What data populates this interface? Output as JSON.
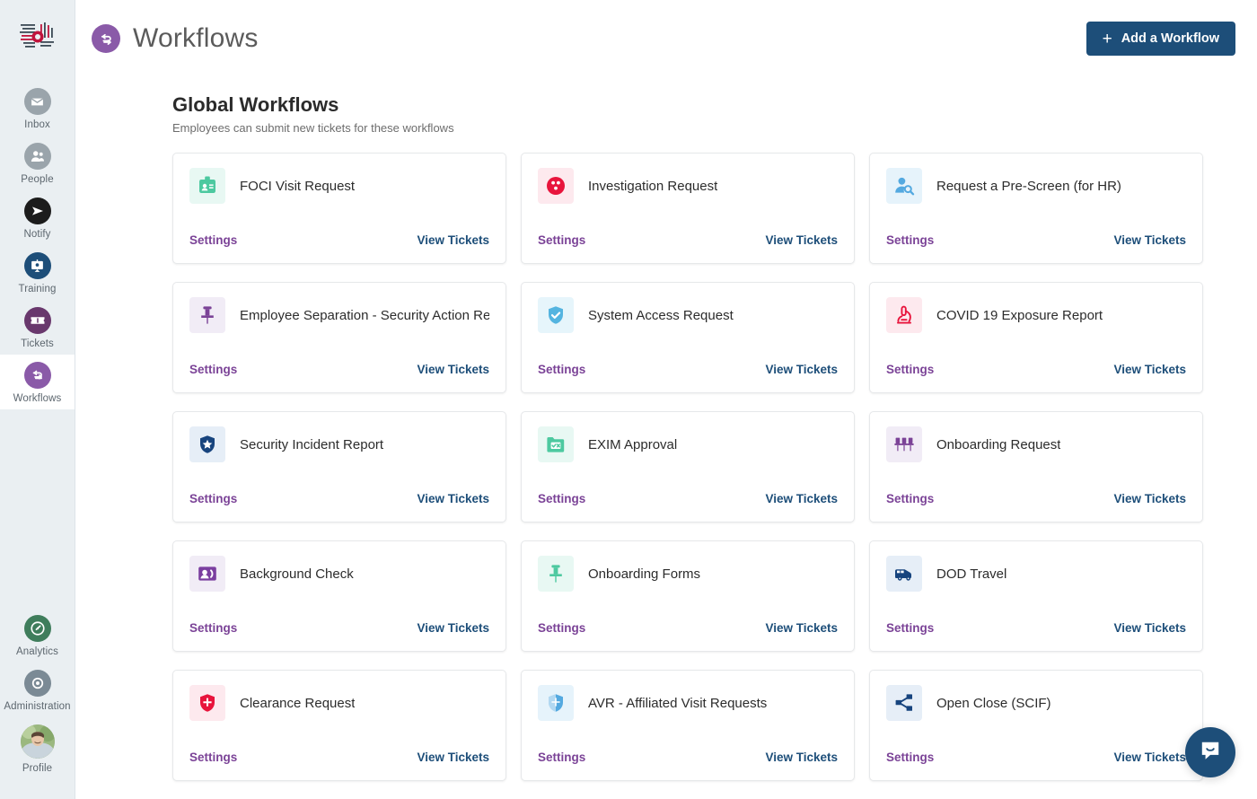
{
  "sidebar": {
    "logo_name": "company-logo",
    "items": [
      {
        "label": "Inbox",
        "icon": "inbox-envelope-icon",
        "color": "#9aa4ab",
        "active": false
      },
      {
        "label": "People",
        "icon": "people-icon",
        "color": "#9aa4ab",
        "active": false
      },
      {
        "label": "Notify",
        "icon": "notify-paper-plane-icon",
        "color": "#1c1c1c",
        "active": false
      },
      {
        "label": "Training",
        "icon": "training-presentation-icon",
        "color": "#1d4e79",
        "active": false
      },
      {
        "label": "Tickets",
        "icon": "ticket-icon",
        "color": "#69386d",
        "active": false
      },
      {
        "label": "Workflows",
        "icon": "workflows-arrows-icon",
        "color": "#8a5aa8",
        "active": true
      }
    ],
    "bottom_items": [
      {
        "label": "Analytics",
        "icon": "analytics-gauge-icon",
        "color": "#3f7d5c",
        "active": false
      },
      {
        "label": "Administration",
        "icon": "administration-target-icon",
        "color": "#7b8a95",
        "active": false
      }
    ],
    "profile": {
      "label": "Profile",
      "icon": "avatar"
    }
  },
  "topbar": {
    "icon": "workflows-arrows-icon",
    "title": "Workflows",
    "add_button_label": "Add a Workflow",
    "add_button_icon": "plus-icon",
    "accent": "#1d4e79"
  },
  "section": {
    "title": "Global Workflows",
    "subtitle": "Employees can submit new tickets for these workflows"
  },
  "links": {
    "settings": "Settings",
    "view_tickets": "View Tickets",
    "settings_color": "#7b4397",
    "view_tickets_color": "#1d4e79"
  },
  "workflows": [
    {
      "title": "FOCI Visit Request",
      "icon": "id-badge-icon",
      "fg": "#4dc9a0",
      "bg": "#e8f8f3"
    },
    {
      "title": "Investigation Request",
      "icon": "bowling-ball-icon",
      "fg": "#e8143c",
      "bg": "#fde9ee"
    },
    {
      "title": "Request a Pre-Screen (for HR)",
      "icon": "person-search-icon",
      "fg": "#54a9e0",
      "bg": "#e6f3fb"
    },
    {
      "title": "Employee Separation - Security Action Required",
      "icon": "pin-icon",
      "fg": "#7b4397",
      "bg": "#f1ecf6"
    },
    {
      "title": "System Access Request",
      "icon": "shield-check-icon",
      "fg": "#54b4e0",
      "bg": "#e6f5fb"
    },
    {
      "title": "COVID 19 Exposure Report",
      "icon": "microscope-icon",
      "fg": "#e8143c",
      "bg": "#fde9ee"
    },
    {
      "title": "Security Incident Report",
      "icon": "shield-star-icon",
      "fg": "#17447e",
      "bg": "#e6eef7"
    },
    {
      "title": "EXIM Approval",
      "icon": "folder-check-icon",
      "fg": "#4dc9a0",
      "bg": "#e8f8f3"
    },
    {
      "title": "Onboarding Request",
      "icon": "three-pins-icon",
      "fg": "#7b4397",
      "bg": "#f1ecf6"
    },
    {
      "title": "Background Check",
      "icon": "contact-card-icon",
      "fg": "#7b3fa0",
      "bg": "#f1ecf6"
    },
    {
      "title": "Onboarding Forms",
      "icon": "pin-icon",
      "fg": "#4dc9a0",
      "bg": "#e8f8f3"
    },
    {
      "title": "DOD Travel",
      "icon": "van-icon",
      "fg": "#17447e",
      "bg": "#e6eef7"
    },
    {
      "title": "Clearance Request",
      "icon": "shield-plus-icon",
      "fg": "#e8143c",
      "bg": "#fde9ee"
    },
    {
      "title": "AVR - Affiliated Visit Requests",
      "icon": "shield-half-icon",
      "fg": "#54a9e0",
      "bg": "#e6f3fb"
    },
    {
      "title": "Open Close (SCIF)",
      "icon": "share-network-icon",
      "fg": "#17447e",
      "bg": "#e6eef7"
    }
  ],
  "chat_widget": {
    "icon": "chat-smile-icon",
    "color": "#1d4e79"
  }
}
